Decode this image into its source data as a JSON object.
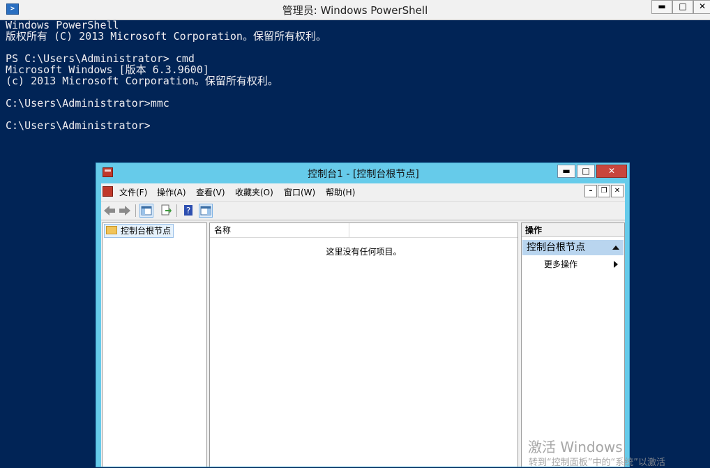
{
  "powershell": {
    "title": "管理员: Windows PowerShell",
    "window_controls": {
      "minimize": "▬",
      "maximize": "□",
      "close": "✕"
    },
    "console_lines": [
      "Windows PowerShell",
      "版权所有 (C) 2013 Microsoft Corporation。保留所有权利。",
      "",
      "PS C:\\Users\\Administrator> cmd",
      "Microsoft Windows [版本 6.3.9600]",
      "(c) 2013 Microsoft Corporation。保留所有权利。",
      "",
      "C:\\Users\\Administrator>mmc",
      "",
      "C:\\Users\\Administrator>"
    ]
  },
  "mmc": {
    "title": "控制台1 - [控制台根节点]",
    "window_controls": {
      "minimize": "▬",
      "maximize": "□",
      "close": "✕"
    },
    "child_controls": {
      "minimize": "–",
      "restore": "❐",
      "close": "✕"
    },
    "menu": [
      "文件(F)",
      "操作(A)",
      "查看(V)",
      "收藏夹(O)",
      "窗口(W)",
      "帮助(H)"
    ],
    "toolbar": {
      "back": "arrow-left-icon",
      "forward": "arrow-right-icon",
      "show_hide_tree": "console-tree-icon",
      "export_list": "export-list-icon",
      "help": "help-icon",
      "show_hide_action": "action-pane-icon"
    },
    "tree": {
      "root": "控制台根节点"
    },
    "list": {
      "column_name": "名称",
      "empty_message": "这里没有任何项目。"
    },
    "actions": {
      "header": "操作",
      "section": "控制台根节点",
      "more": "更多操作"
    }
  },
  "watermark": {
    "title": "激活 Windows",
    "subtitle": "转到“控制面板”中的“系统”以激活"
  },
  "colors": {
    "console_background": "#012456",
    "console_text": "#eeedf0",
    "mmc_frame": "#66cbea",
    "mmc_close": "#c8463d"
  }
}
